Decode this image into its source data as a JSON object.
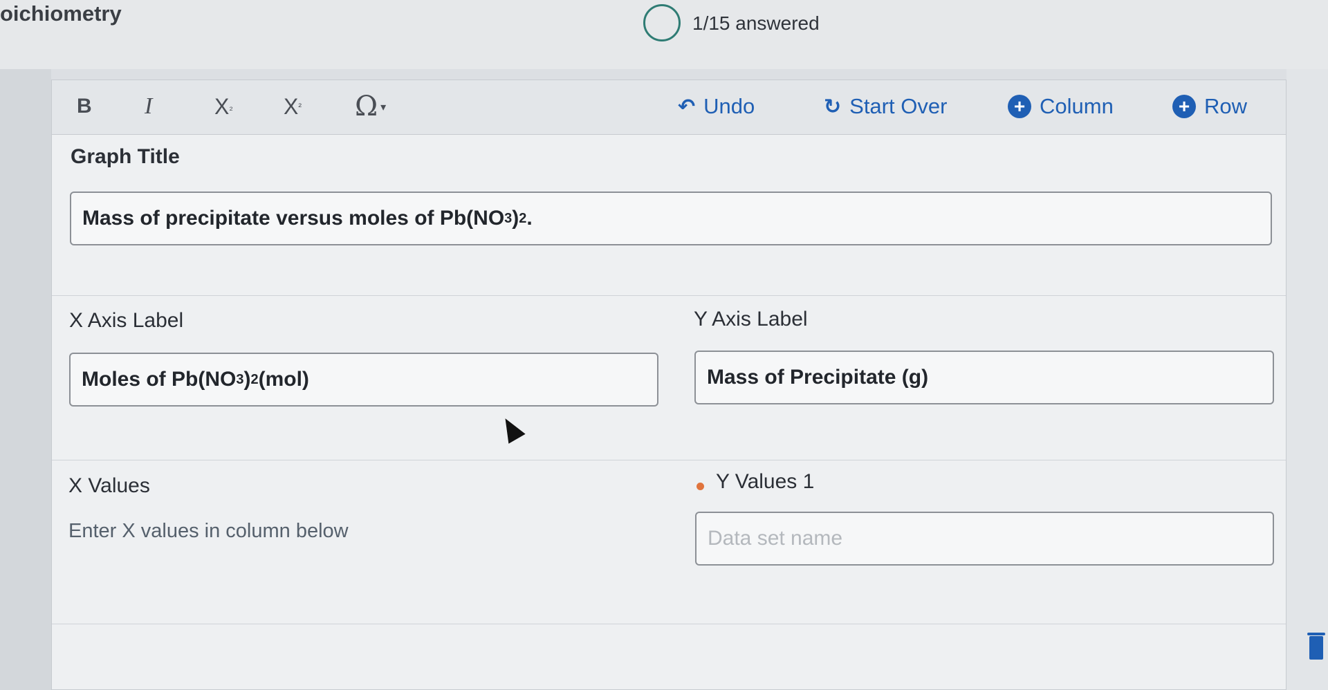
{
  "header": {
    "title": "oichiometry",
    "progress": "1/15 answered"
  },
  "toolbar": {
    "bold": "B",
    "italic": "I",
    "subscript": "X",
    "subscript_mark": "₂",
    "superscript": "X",
    "superscript_mark": "²",
    "special_chars": "Ω",
    "undo": "Undo",
    "start_over": "Start Over",
    "add_column": "Column",
    "add_row": "Row"
  },
  "graph": {
    "title_label": "Graph Title",
    "title_pre": "Mass of precipitate versus moles of Pb(NO",
    "title_sub1": "3",
    "title_mid": ")",
    "title_sub2": "2",
    "title_post": "."
  },
  "x_axis": {
    "label": "X Axis Label",
    "value_pre": "Moles of Pb(NO",
    "value_sub1": "3",
    "value_mid": ")",
    "value_sub2": "2",
    "value_post": " (mol)"
  },
  "y_axis": {
    "label": "Y Axis Label",
    "value": "Mass of Precipitate (g)"
  },
  "x_values": {
    "label": "X Values",
    "hint": "Enter X values in column below"
  },
  "y_values": {
    "label": "Y Values 1",
    "placeholder": "Data set name",
    "series_color": "#e0743d"
  }
}
